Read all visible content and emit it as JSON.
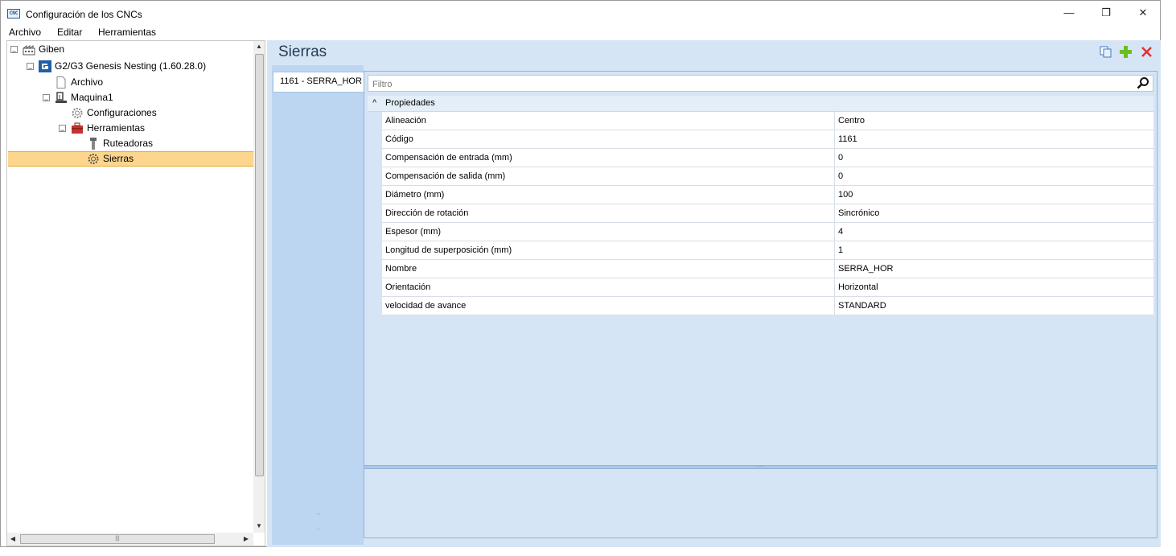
{
  "window": {
    "title": "Configuración de los CNCs",
    "app_icon_text": "CNC",
    "minimize": "—",
    "maximize": "❐",
    "close": "✕"
  },
  "menu": {
    "items": [
      "Archivo",
      "Editar",
      "Herramientas"
    ]
  },
  "tree": {
    "nodes": [
      {
        "label": "Giben",
        "expander": "⊟",
        "icon": "factory-icon"
      },
      {
        "label": "G2/G3 Genesis Nesting (1.60.28.0)",
        "expander": "⊟",
        "icon": "giben-logo-icon"
      },
      {
        "label": "Archivo",
        "icon": "document-icon"
      },
      {
        "label": "Maquina1",
        "expander": "⊟",
        "icon": "machine-icon"
      },
      {
        "label": "Configuraciones",
        "icon": "gear-icon"
      },
      {
        "label": "Herramientas",
        "expander": "⊟",
        "icon": "toolbox-icon"
      },
      {
        "label": "Ruteadoras",
        "icon": "router-bit-icon"
      },
      {
        "label": "Sierras",
        "icon": "saw-gear-icon",
        "selected": true
      }
    ],
    "scroll_up": "▲",
    "scroll_down": "▼",
    "scroll_left": "◀",
    "scroll_right": "▶",
    "hgrip": "|||"
  },
  "panel": {
    "title": "Sierras",
    "copy_icon": "copy-icon",
    "add_icon": "plus-icon",
    "delete_icon": "delete-x-icon",
    "accent_add": "#6abf1e",
    "accent_delete": "#e03030"
  },
  "tabs": {
    "items": [
      "1161 - SERRA_HOR"
    ],
    "arrow_up": "⌃",
    "arrow_down": "⌄"
  },
  "filter": {
    "placeholder": "Filtro",
    "value": ""
  },
  "properties": {
    "category": "Propiedades",
    "toggle": "^",
    "rows": [
      {
        "name": "Alineación",
        "value": "Centro"
      },
      {
        "name": "Código",
        "value": "1161"
      },
      {
        "name": "Compensación de entrada (mm)",
        "value": "0"
      },
      {
        "name": "Compensación de salida (mm)",
        "value": "0"
      },
      {
        "name": "Diámetro (mm)",
        "value": "100"
      },
      {
        "name": "Dirección de rotación",
        "value": "Sincrónico"
      },
      {
        "name": "Espesor (mm)",
        "value": "4"
      },
      {
        "name": "Longitud de superposición (mm)",
        "value": "1"
      },
      {
        "name": "Nombre",
        "value": "SERRA_HOR"
      },
      {
        "name": "Orientación",
        "value": "Horizontal"
      },
      {
        "name": "velocidad de avance",
        "value": "STANDARD"
      }
    ],
    "splitter_grip": "·····"
  }
}
